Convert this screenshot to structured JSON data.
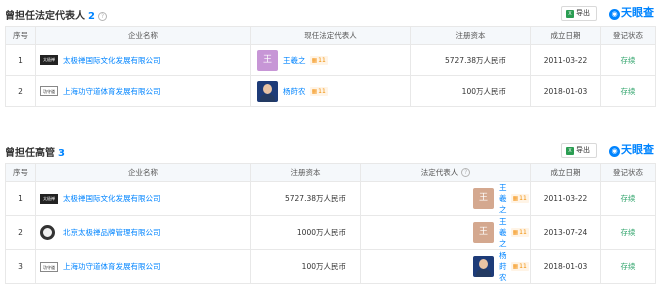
{
  "section1": {
    "title": "曾担任法定代表人",
    "count": "2",
    "export_label": "导出",
    "brand": "天眼查",
    "headers": [
      "序号",
      "企业名称",
      "现任法定代表人",
      "注册资本",
      "成立日期",
      "登记状态"
    ],
    "rows": [
      {
        "no": "1",
        "logo": "太极禅",
        "company": "太极禅国际文化发展有限公司",
        "avatar_char": "王",
        "person": "王羲之",
        "badge": "11",
        "capital": "5727.38万人民币",
        "date": "2011-03-22",
        "status": "存续"
      },
      {
        "no": "2",
        "logo": "功守道",
        "company": "上海功守道体育发展有限公司",
        "person": "杨莳农",
        "badge": "11",
        "capital": "100万人民币",
        "date": "2018-01-03",
        "status": "存续"
      }
    ]
  },
  "section2": {
    "title": "曾担任高管",
    "count": "3",
    "export_label": "导出",
    "brand": "天眼查",
    "headers": [
      "序号",
      "企业名称",
      "注册资本",
      "法定代表人",
      "成立日期",
      "登记状态"
    ],
    "rows": [
      {
        "no": "1",
        "logo": "太极禅",
        "company": "太极禅国际文化发展有限公司",
        "capital": "5727.38万人民币",
        "avatar_char": "王",
        "person": "王羲之",
        "badge": "11",
        "date": "2011-03-22",
        "status": "存续"
      },
      {
        "no": "2",
        "company": "北京太极禅品牌管理有限公司",
        "capital": "1000万人民币",
        "avatar_char": "王",
        "person": "王羲之",
        "badge": "11",
        "date": "2013-07-24",
        "status": "存续"
      },
      {
        "no": "3",
        "logo": "功守道",
        "company": "上海功守道体育发展有限公司",
        "capital": "100万人民币",
        "person": "杨莳农",
        "badge": "11",
        "date": "2018-01-03",
        "status": "存续"
      }
    ]
  },
  "colors": {
    "link": "#0084ff",
    "status": "#2ea36a",
    "header_bg": "#f5f8fb"
  }
}
